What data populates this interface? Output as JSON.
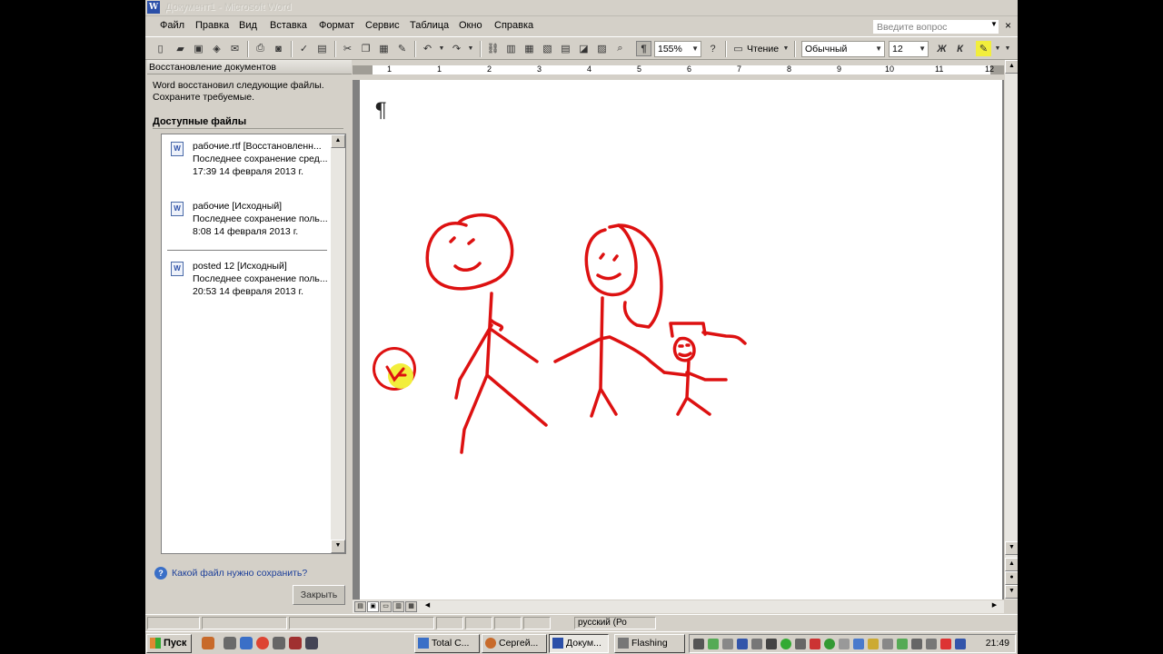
{
  "window": {
    "title": "Документ1 - Microsoft Word",
    "app_icon": "W"
  },
  "menu": {
    "items": [
      "Файл",
      "Правка",
      "Вид",
      "Вставка",
      "Формат",
      "Сервис",
      "Таблица",
      "Окно",
      "Справка"
    ],
    "ask_placeholder": "Введите вопрос",
    "close_glyph": "×"
  },
  "toolbar": {
    "zoom": "155%",
    "read_label": "Чтение",
    "style": "Обычный",
    "size": "12",
    "bold": "Ж",
    "italic": "К",
    "pilcrow": "¶"
  },
  "ruler": {
    "numbers": [
      "1",
      "1",
      "2",
      "3",
      "4",
      "5",
      "6",
      "7",
      "8",
      "9",
      "10",
      "11",
      "12"
    ]
  },
  "taskpane": {
    "title": "Восстановление документов",
    "description": "Word восстановил следующие файлы. Сохраните требуемые.",
    "available": "Доступные файлы",
    "files": [
      {
        "name": "рабочие.rtf  [Восстановленн...",
        "status": "Последнее сохранение сред...",
        "time": "17:39 14 февраля 2013 г."
      },
      {
        "name": "рабочие  [Исходный]",
        "status": "Последнее сохранение поль...",
        "time": "8:08 14 февраля 2013 г."
      },
      {
        "name": "posted 12  [Исходный]",
        "status": "Последнее сохранение поль...",
        "time": "20:53 14 февраля 2013 г."
      }
    ],
    "help_link": "Какой файл нужно сохранить?",
    "close_button": "Закрыть"
  },
  "document": {
    "pilcrow": "¶"
  },
  "statusbar": {
    "language": "русский (Ро"
  },
  "taskbar": {
    "start": "Пуск",
    "tasks": [
      "Total C...",
      "Сергей...",
      "Докум...",
      "Flashing"
    ],
    "clock": "21:49"
  },
  "colors": {
    "ink": "#dd1111",
    "highlight": "#f2ee3c"
  }
}
